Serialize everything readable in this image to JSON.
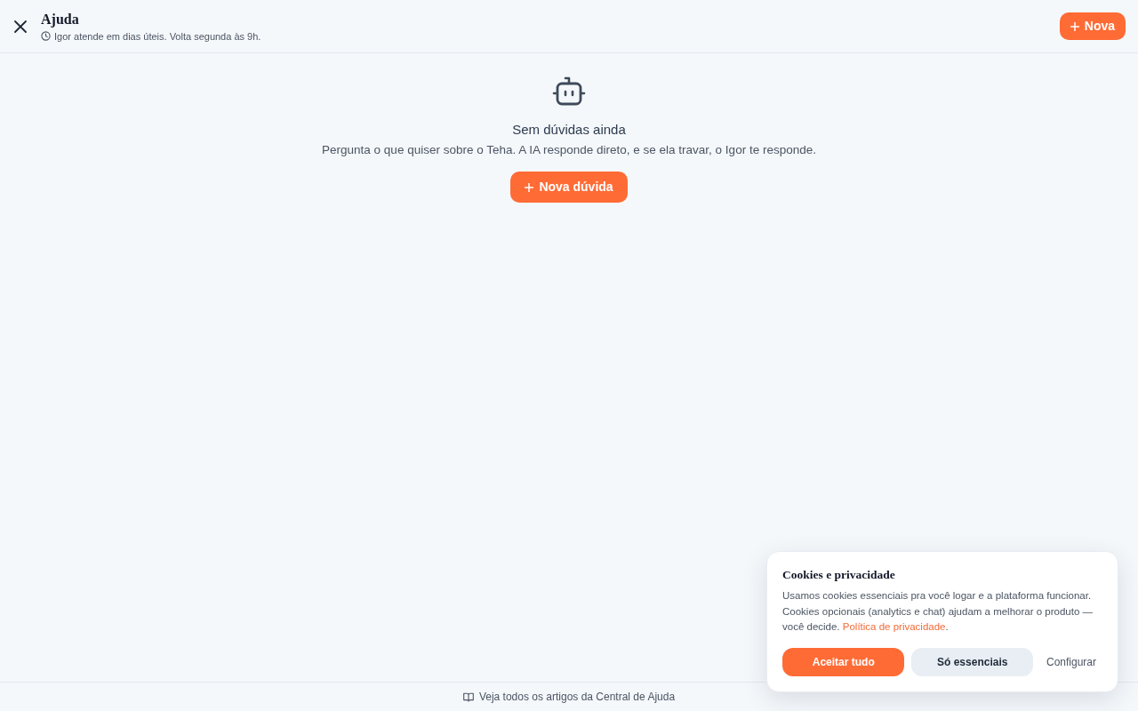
{
  "header": {
    "title": "Ajuda",
    "subtitle": "Igor atende em dias úteis. Volta segunda às 9h.",
    "new_button": "Nova"
  },
  "empty_state": {
    "heading": "Sem dúvidas ainda",
    "text": "Pergunta o que quiser sobre o Teha. A IA responde direto, e se ela travar, o Igor te responde.",
    "button": "Nova dúvida"
  },
  "footer": {
    "link": "Veja todos os artigos da Central de Ajuda"
  },
  "cookie_banner": {
    "title": "Cookies e privacidade",
    "text": "Usamos cookies essenciais pra você logar e a plataforma funcionar. Cookies opcionais (analytics e chat) ajudam a melhorar o produto — você decide.",
    "link": "Política de privacidade",
    "text_end": ".",
    "buttons": [
      {
        "label": "Aceitar tudo",
        "kind": "primary"
      },
      {
        "label": "Só essenciais",
        "kind": "secondary"
      },
      {
        "label": "Configurar",
        "kind": "text"
      }
    ]
  }
}
